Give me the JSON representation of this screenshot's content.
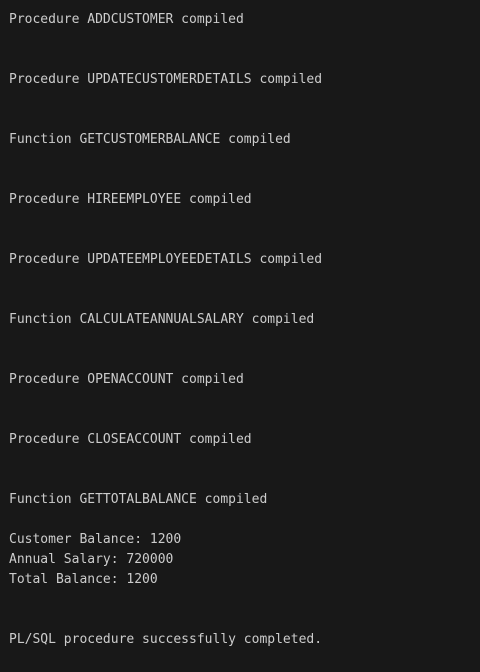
{
  "output": {
    "compiled": [
      "Procedure ADDCUSTOMER compiled",
      "Procedure UPDATECUSTOMERDETAILS compiled",
      "Function GETCUSTOMERBALANCE compiled",
      "Procedure HIREEMPLOYEE compiled",
      "Procedure UPDATEEMPLOYEEDETAILS compiled",
      "Function CALCULATEANNUALSALARY compiled",
      "Procedure OPENACCOUNT compiled",
      "Procedure CLOSEACCOUNT compiled",
      "Function GETTOTALBALANCE compiled"
    ],
    "results": [
      "Customer Balance: 1200",
      "Annual Salary: 720000",
      "Total Balance: 1200"
    ],
    "completion": "PL/SQL procedure successfully completed."
  },
  "colors": {
    "background": "#181818",
    "text": "#cccccc"
  }
}
